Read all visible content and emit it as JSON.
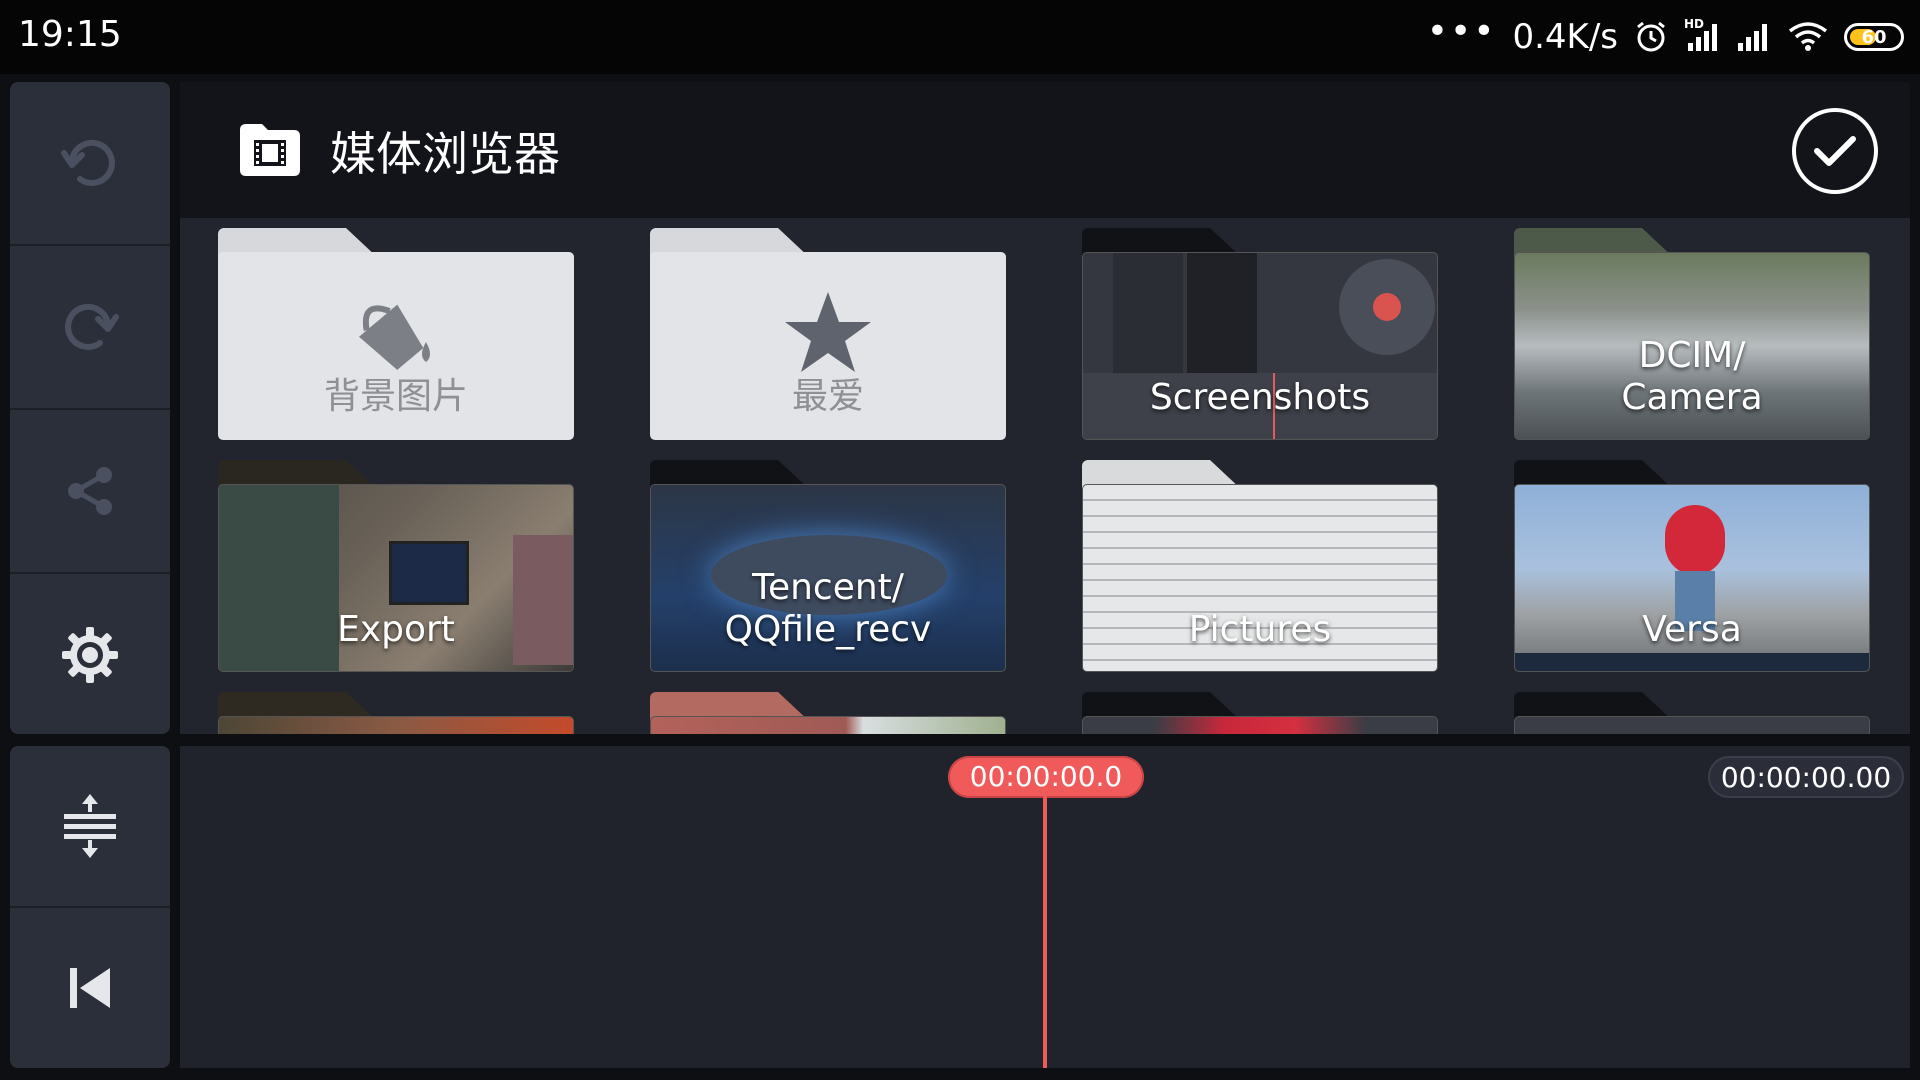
{
  "status_bar": {
    "time": "19:15",
    "dots": "•••",
    "net_speed": "0.4K/s",
    "hd_badge": "HD",
    "battery_level": "60",
    "battery_fraction": 0.6
  },
  "side_rail": {
    "undo": "undo-icon",
    "redo": "redo-icon",
    "share": "share-icon",
    "settings": "gear-icon",
    "zoom": "track-expand-icon",
    "skip_start": "skip-to-start-icon"
  },
  "media_browser": {
    "title": "媒体浏览器",
    "folders": [
      {
        "label": "背景图片",
        "icon": "paint-bucket-icon"
      },
      {
        "label": "最爱",
        "icon": "star-icon"
      },
      {
        "label": "Screenshots"
      },
      {
        "label_line1": "DCIM/",
        "label_line2": "Camera"
      },
      {
        "label": "Export"
      },
      {
        "label_line1": "Tencent/",
        "label_line2": "QQfile_recv"
      },
      {
        "label": "Pictures"
      },
      {
        "label": "Versa"
      }
    ]
  },
  "timeline": {
    "current_time": "00:00:00.0",
    "total_time": "00:00:00.00"
  },
  "colors": {
    "accent_red": "#f15a5a",
    "battery_yellow": "#ffc21a"
  }
}
